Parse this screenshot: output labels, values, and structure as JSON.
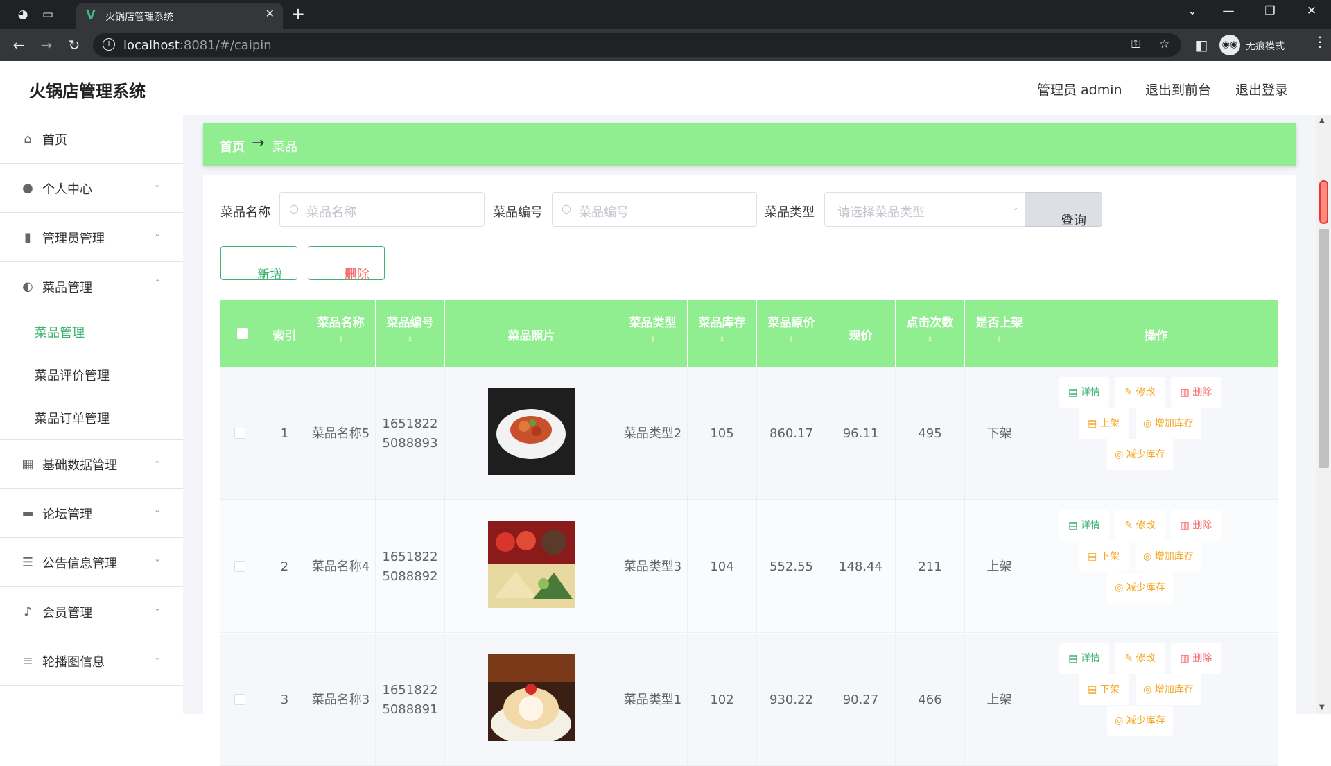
{
  "browser": {
    "tab_title": "火锅店管理系统",
    "url_host": "localhost",
    "url_rest": ":8081/#/caipin",
    "incognito_label": "无痕模式"
  },
  "header": {
    "title": "火锅店管理系统",
    "user": "管理员 admin",
    "to_front": "退出到前台",
    "logout": "退出登录"
  },
  "sidebar": {
    "home": "首页",
    "profile": "个人中心",
    "admin": "管理员管理",
    "dish": "菜品管理",
    "dish_subs": [
      "菜品管理",
      "菜品评价管理",
      "菜品订单管理"
    ],
    "basic": "基础数据管理",
    "forum": "论坛管理",
    "notice": "公告信息管理",
    "member": "会员管理",
    "carousel": "轮播图信息"
  },
  "breadcrumb": {
    "home": "首页",
    "arrow": "→",
    "current": "菜品"
  },
  "filters": {
    "name_label": "菜品名称",
    "name_placeholder": "菜品名称",
    "code_label": "菜品编号",
    "code_placeholder": "菜品编号",
    "type_label": "菜品类型",
    "type_placeholder": "请选择菜品类型",
    "query": "查询"
  },
  "actions": {
    "add": "新增",
    "delete": "删除"
  },
  "table": {
    "columns": [
      "索引",
      "菜品名称",
      "菜品编号",
      "菜品照片",
      "菜品类型",
      "菜品库存",
      "菜品原价",
      "现价",
      "点击次数",
      "是否上架",
      "操作"
    ],
    "rows": [
      {
        "index": "1",
        "name": "菜品名称5",
        "code": "16518225088893",
        "type": "菜品类型2",
        "stock": "105",
        "orig": "860.17",
        "price": "96.11",
        "clicks": "495",
        "status": "下架",
        "toggle": "上架"
      },
      {
        "index": "2",
        "name": "菜品名称4",
        "code": "16518225088892",
        "type": "菜品类型3",
        "stock": "104",
        "orig": "552.55",
        "price": "148.44",
        "clicks": "211",
        "status": "上架",
        "toggle": "下架"
      },
      {
        "index": "3",
        "name": "菜品名称3",
        "code": "16518225088891",
        "type": "菜品类型1",
        "stock": "102",
        "orig": "930.22",
        "price": "90.27",
        "clicks": "466",
        "status": "上架",
        "toggle": "下架"
      }
    ],
    "ops": {
      "detail": "详情",
      "edit": "修改",
      "delete": "删除",
      "add_stock": "增加库存",
      "reduce_stock": "减少库存"
    }
  },
  "colors": {
    "accent": "#90ee90",
    "green": "#3cb371",
    "orange": "#f5a623",
    "red": "#f56c6c"
  }
}
